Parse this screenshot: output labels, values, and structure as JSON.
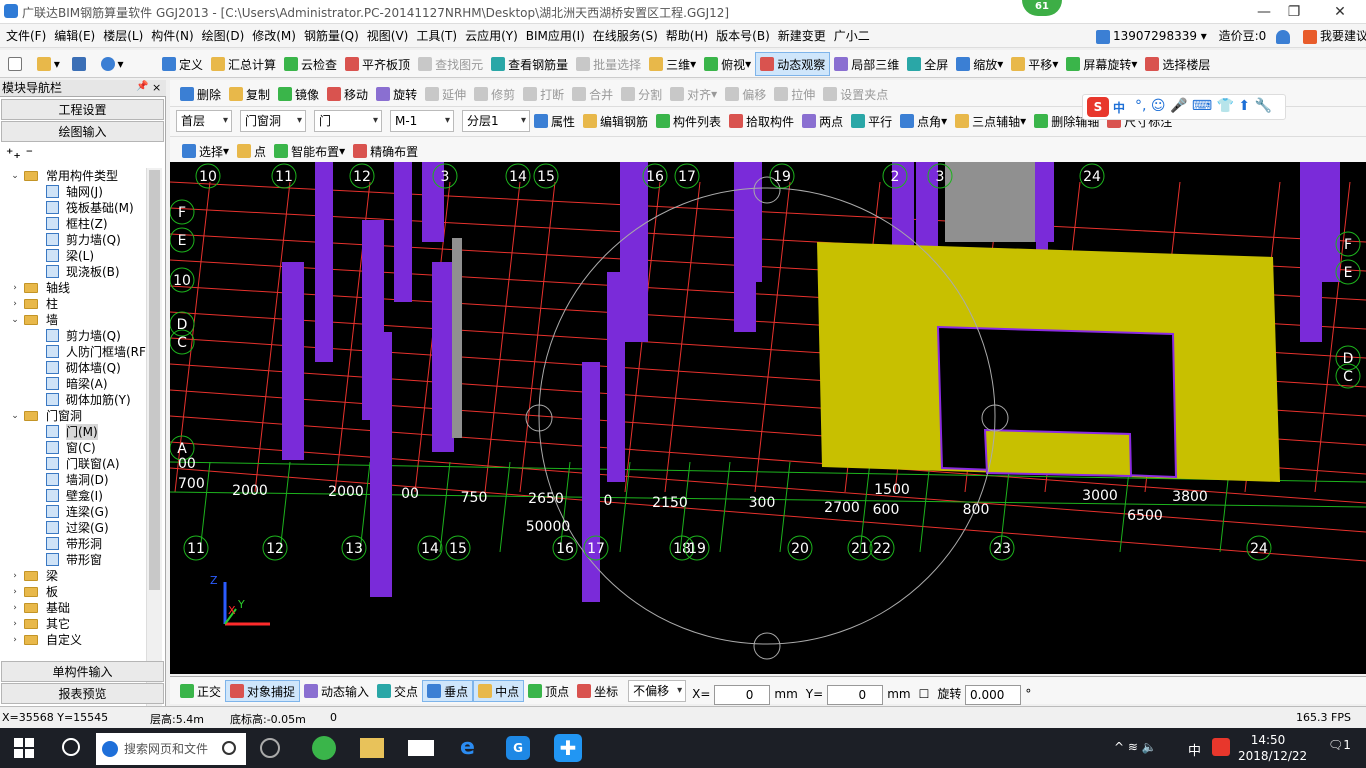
{
  "title": "广联达BIM钢筋算量软件 GGJ2013 - [C:\\Users\\Administrator.PC-20141127NRHM\\Desktop\\湖北洲天西湖桥安置区工程.GGJ12]",
  "badge": "61",
  "window_controls": {
    "minimize": "—",
    "restore": "❐",
    "close": "✕"
  },
  "menu": [
    "文件(F)",
    "编辑(E)",
    "楼层(L)",
    "构件(N)",
    "绘图(D)",
    "修改(M)",
    "钢筋量(Q)",
    "视图(V)",
    "工具(T)",
    "云应用(Y)",
    "BIM应用(I)",
    "在线服务(S)",
    "帮助(H)",
    "版本号(B)",
    "新建变更",
    "广小二"
  ],
  "account": {
    "phone": "13907298339",
    "price": "造价豆:0",
    "suggest": "我要建议"
  },
  "toolbar1": [
    "定义",
    "汇总计算",
    "云检查",
    "平齐板顶",
    "查找图元",
    "查看钢筋量",
    "批量选择",
    "三维",
    "俯视",
    "动态观察",
    "局部三维",
    "全屏",
    "缩放",
    "平移",
    "屏幕旋转",
    "选择楼层"
  ],
  "toolbar2": [
    "删除",
    "复制",
    "镜像",
    "移动",
    "旋转",
    "延伸",
    "修剪",
    "打断",
    "合并",
    "分割",
    "对齐",
    "偏移",
    "拉伸",
    "设置夹点"
  ],
  "combos": [
    "首层",
    "门窗洞",
    "门",
    "M-1",
    "分层1"
  ],
  "toolbar3": [
    "属性",
    "编辑钢筋",
    "构件列表",
    "拾取构件",
    "两点",
    "平行",
    "点角",
    "三点辅轴",
    "删除辅轴",
    "尺寸标注"
  ],
  "toolbar4": [
    "选择",
    "点",
    "智能布置",
    "精确布置"
  ],
  "nav": {
    "header": "模块导航栏",
    "btn_project": "工程设置",
    "btn_draw": "绘图输入",
    "btn_single": "单构件输入",
    "btn_report": "报表预览"
  },
  "tree": [
    {
      "level": 0,
      "exp": "−",
      "folder": true,
      "label": "常用构件类型"
    },
    {
      "level": 1,
      "label": "轴网(J)"
    },
    {
      "level": 1,
      "label": "筏板基础(M)"
    },
    {
      "level": 1,
      "label": "框柱(Z)"
    },
    {
      "level": 1,
      "label": "剪力墙(Q)"
    },
    {
      "level": 1,
      "label": "梁(L)"
    },
    {
      "level": 1,
      "label": "现浇板(B)"
    },
    {
      "level": 0,
      "exp": "+",
      "folder": true,
      "label": "轴线"
    },
    {
      "level": 0,
      "exp": "+",
      "folder": true,
      "label": "柱"
    },
    {
      "level": 0,
      "exp": "−",
      "folder": true,
      "label": "墙"
    },
    {
      "level": 1,
      "label": "剪力墙(Q)"
    },
    {
      "level": 1,
      "label": "人防门框墙(RF"
    },
    {
      "level": 1,
      "label": "砌体墙(Q)"
    },
    {
      "level": 1,
      "label": "暗梁(A)"
    },
    {
      "level": 1,
      "label": "砌体加筋(Y)"
    },
    {
      "level": 0,
      "exp": "−",
      "folder": true,
      "label": "门窗洞"
    },
    {
      "level": 1,
      "label": "门(M)",
      "selected": true
    },
    {
      "level": 1,
      "label": "窗(C)"
    },
    {
      "level": 1,
      "label": "门联窗(A)"
    },
    {
      "level": 1,
      "label": "墙洞(D)"
    },
    {
      "level": 1,
      "label": "壁龛(I)"
    },
    {
      "level": 1,
      "label": "连梁(G)"
    },
    {
      "level": 1,
      "label": "过梁(G)"
    },
    {
      "level": 1,
      "label": "带形洞"
    },
    {
      "level": 1,
      "label": "带形窗"
    },
    {
      "level": 0,
      "exp": "+",
      "folder": true,
      "label": "梁"
    },
    {
      "level": 0,
      "exp": "+",
      "folder": true,
      "label": "板"
    },
    {
      "level": 0,
      "exp": "+",
      "folder": true,
      "label": "基础"
    },
    {
      "level": 0,
      "exp": "+",
      "folder": true,
      "label": "其它"
    },
    {
      "level": 0,
      "exp": "+",
      "folder": true,
      "label": "自定义"
    }
  ],
  "viewport": {
    "axis_top": [
      "10",
      "11",
      "12",
      "3",
      "14",
      "15",
      "16",
      "17",
      "19",
      "2",
      "3",
      "24"
    ],
    "axis_side_left": [
      "F",
      "E",
      "10",
      "D",
      "C",
      "A",
      "00",
      "700"
    ],
    "axis_side_right": [
      "F",
      "E",
      "D",
      "C"
    ],
    "axis_bottom": [
      "11",
      "12",
      "13",
      "14",
      "15",
      "16",
      "17",
      "18",
      "19",
      "20",
      "21",
      "22",
      "23",
      "24"
    ],
    "dims_row1": [
      "2000",
      "2000",
      "00",
      "750",
      "2650",
      "0",
      "2150",
      "300",
      "2700",
      "1500",
      "600",
      "800",
      "3000",
      "3800"
    ],
    "dims_row2": [
      "50000",
      "6500"
    ],
    "triad": {
      "x": "X",
      "y": "Y",
      "z": "Z"
    }
  },
  "status_tools": [
    "正交",
    "对象捕捉",
    "动态输入",
    "交点",
    "垂点",
    "中点",
    "顶点",
    "坐标"
  ],
  "offset_combo": "不偏移",
  "x_label": "X=",
  "x_val": "0",
  "y_label": "Y=",
  "y_val": "0",
  "unit": "mm",
  "rotate_label": "旋转",
  "rotate_val": "0.000",
  "deg": "°",
  "info": {
    "coords": "X=35568 Y=15545",
    "floor_h": "层高:5.4m",
    "base_h": "底标高:-0.05m",
    "zero": "0",
    "fps": "165.3 FPS"
  },
  "taskbar": {
    "search": "搜索网页和文件",
    "time": "14:50",
    "date": "2018/12/22",
    "ime": "中",
    "notif": "1"
  },
  "sogou": {
    "ime": "中"
  }
}
